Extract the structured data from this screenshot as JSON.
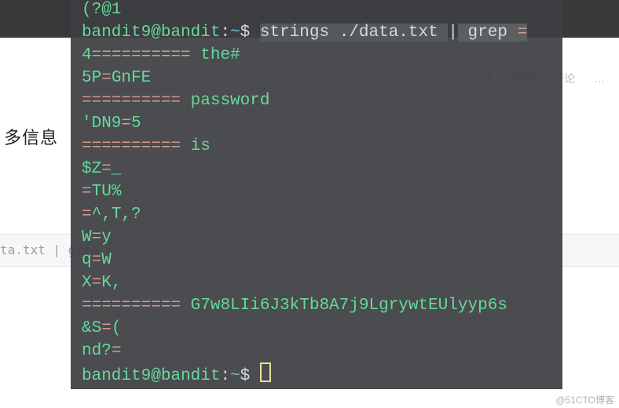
{
  "background": {
    "cn_label": "多信息",
    "gray_code": "ta.txt | grep =",
    "right_buttons": [
      "分享",
      "收藏",
      "评论",
      "…"
    ]
  },
  "terminal": {
    "line0": "(?@1",
    "prompt_user": "bandit9@bandit",
    "prompt_colon": ":",
    "prompt_path": "~",
    "prompt_dollar": "$ ",
    "cmd_part1": "strings ./data.txt ",
    "cmd_pipe": "|",
    "cmd_part2": " grep ",
    "cmd_part3": "=",
    "out": {
      "l1a": "4",
      "l1b": "==========",
      "l1c": " the#",
      "l2a": "5P",
      "l2b": "=",
      "l2c": "GnFE",
      "l3a": "==========",
      "l3b": " password",
      "l4a": "'DN9",
      "l4b": "=",
      "l4c": "5",
      "l5a": "==========",
      "l5b": " is",
      "l6a": "$Z",
      "l6b": "=",
      "l6c": "_",
      "l7a": "=",
      "l7b": "TU%",
      "l8a": "=",
      "l8b": "^,T,?",
      "l9a": "W",
      "l9b": "=",
      "l9c": "y",
      "l10a": "q",
      "l10b": "=",
      "l10c": "W",
      "l11a": "X",
      "l11b": "=",
      "l11c": "K,",
      "l12a": "==========",
      "l12b": " G7w8LIi6J3kTb8A7j9LgrywtEUlyyp6s",
      "l13a": "&S",
      "l13b": "=",
      "l13c": "(",
      "l14a": "nd?",
      "l14b": "="
    }
  },
  "watermark": "@51CTO博客"
}
